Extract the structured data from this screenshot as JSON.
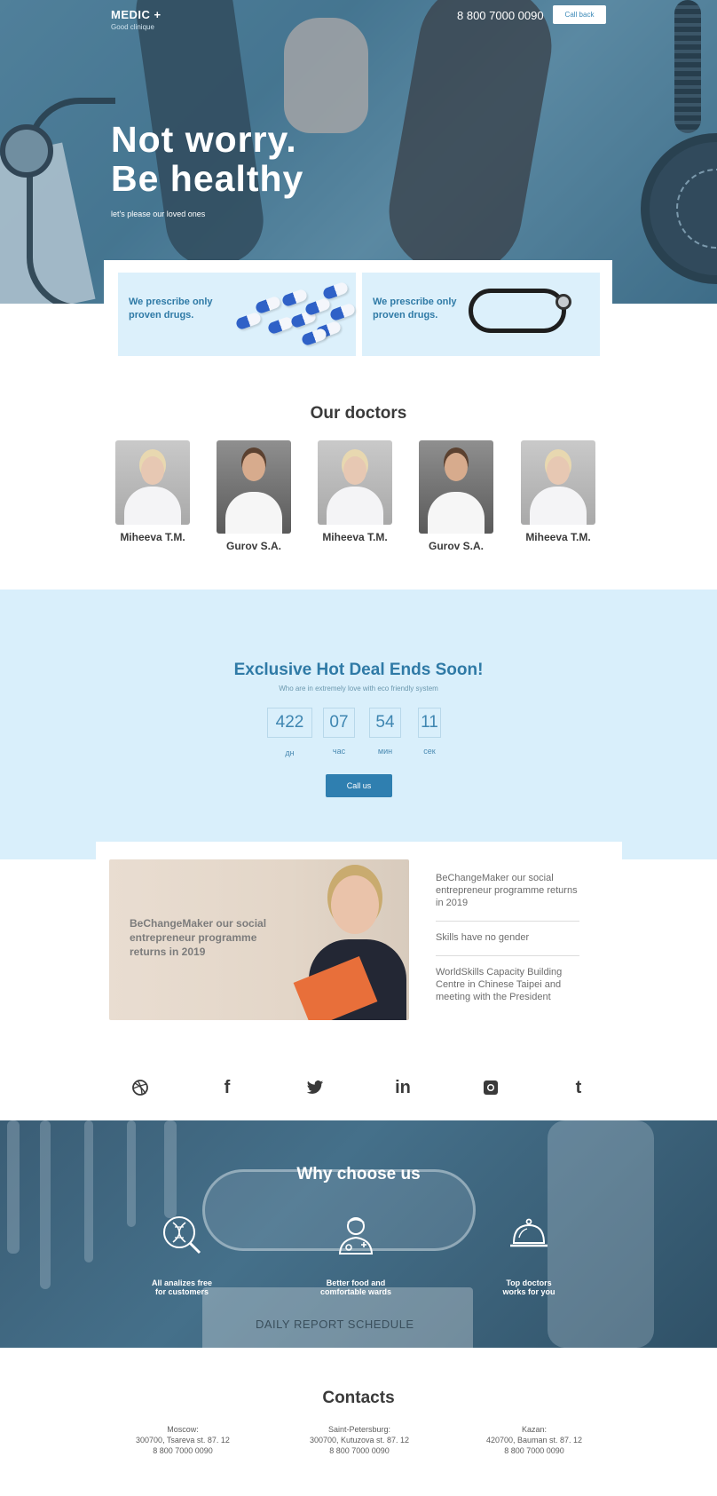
{
  "header": {
    "brand": "MEDIC +",
    "tagline": "Good clinique",
    "phone": "8 800 7000 0090",
    "callback_label": "Call back"
  },
  "hero": {
    "title_line1": "Not worry.",
    "title_line2": "Be healthy",
    "subtitle": "let's please our loved ones"
  },
  "features": [
    {
      "text": "We prescribe only proven drugs.",
      "image": "pills"
    },
    {
      "text": "We prescribe only proven drugs.",
      "image": "stethoscope"
    }
  ],
  "doctors": {
    "title": "Our doctors",
    "items": [
      {
        "name": "Miheeva T.M."
      },
      {
        "name": "Gurov S.A."
      },
      {
        "name": "Miheeva T.M."
      },
      {
        "name": "Gurov S.A."
      },
      {
        "name": "Miheeva T.M."
      }
    ]
  },
  "deal": {
    "title": "Exclusive Hot Deal Ends Soon!",
    "subtitle": "Who are in extremely love with eco friendly system",
    "countdown": [
      {
        "value": "422",
        "label": "дн"
      },
      {
        "value": "07",
        "label": "час"
      },
      {
        "value": "54",
        "label": "мин"
      },
      {
        "value": "11",
        "label": "сек"
      }
    ],
    "button_label": "Call us"
  },
  "news": {
    "featured": "BeChangeMaker our social entrepreneur programme returns in 2019",
    "items": [
      "BeChangeMaker our social entrepreneur programme returns in 2019",
      "Skills have no gender",
      "WorldSkills Capacity Building Centre in Chinese Taipei and meeting with the President"
    ]
  },
  "social": [
    {
      "icon": "dribbble-icon",
      "glyph": "◎"
    },
    {
      "icon": "facebook-icon",
      "glyph": "f"
    },
    {
      "icon": "twitter-icon",
      "glyph": "🐦"
    },
    {
      "icon": "linkedin-icon",
      "glyph": "in"
    },
    {
      "icon": "instagram-icon",
      "glyph": "◙"
    },
    {
      "icon": "tumblr-icon",
      "glyph": "t"
    }
  ],
  "why": {
    "title": "Why choose us",
    "clip_text": "DAILY REPORT SCHEDULE",
    "items": [
      {
        "icon": "dna-search-icon",
        "line1": "All analizes free",
        "line2": "for customers"
      },
      {
        "icon": "doctor-icon",
        "line1": "Better food and",
        "line2": "comfortable wards"
      },
      {
        "icon": "food-tray-icon",
        "line1": "Top doctors",
        "line2": "works for you"
      }
    ]
  },
  "contacts": {
    "title": "Contacts",
    "items": [
      {
        "city": "Moscow:",
        "address": "300700, Tsareva st. 87. 12",
        "phone": "8 800 7000 0090"
      },
      {
        "city": "Saint-Petersburg:",
        "address": "300700, Kutuzova st. 87. 12",
        "phone": "8 800 7000 0090"
      },
      {
        "city": "Kazan:",
        "address": "420700, Bauman st. 87. 12",
        "phone": "8 800 7000 0090"
      }
    ]
  },
  "colors": {
    "accent": "#2f7fb0",
    "light_blue": "#d9effb",
    "dark": "#3a3a3a"
  }
}
